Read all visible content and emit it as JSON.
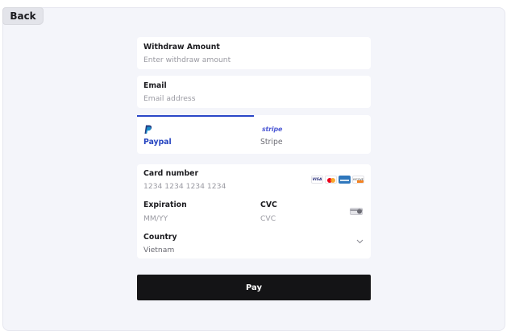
{
  "back": {
    "label": "Back"
  },
  "withdraw": {
    "label": "Withdraw Amount",
    "placeholder": "Enter withdraw amount"
  },
  "email": {
    "label": "Email",
    "placeholder": "Email address"
  },
  "tabs": {
    "selected": "Paypal",
    "items": [
      {
        "label": "Paypal",
        "icon": "paypal-icon"
      },
      {
        "label": "Stripe",
        "logo": "stripe"
      }
    ]
  },
  "card": {
    "number_label": "Card number",
    "number_placeholder": "1234 1234 1234 1234",
    "brands": [
      {
        "name": "visa",
        "text": "VISA"
      },
      {
        "name": "mastercard"
      },
      {
        "name": "amex"
      },
      {
        "name": "discover",
        "text": "DISCOVER"
      }
    ],
    "expiration_label": "Expiration",
    "expiration_placeholder": "MM/YY",
    "cvc_label": "CVC",
    "cvc_placeholder": "CVC",
    "country_label": "Country",
    "country_value": "Vietnam"
  },
  "pay": {
    "label": "Pay"
  },
  "colors": {
    "accent": "#2a46c7",
    "pay_button": "#141416",
    "background": "#f4f5fa"
  }
}
